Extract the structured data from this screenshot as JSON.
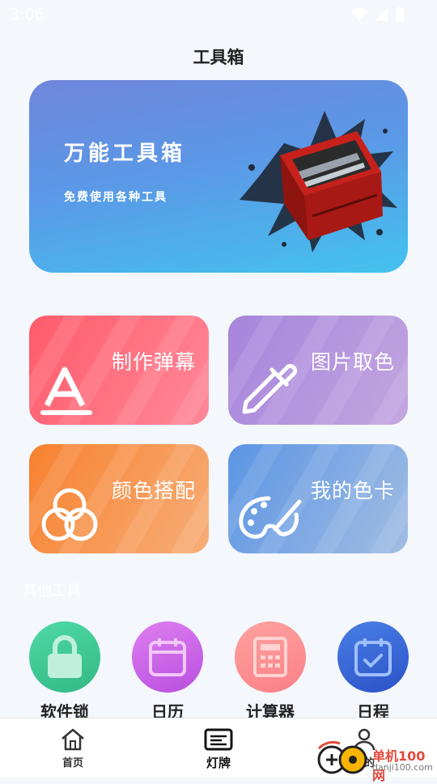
{
  "status": {
    "time": "3:06"
  },
  "header": {
    "title": "工具箱"
  },
  "banner": {
    "title": "万能工具箱",
    "subtitle": "免费使用各种工具"
  },
  "features": [
    {
      "label": "制作弹幕",
      "icon": "letter-a-icon"
    },
    {
      "label": "图片取色",
      "icon": "eyedropper-icon"
    },
    {
      "label": "颜色搭配",
      "icon": "color-circles-icon"
    },
    {
      "label": "我的色卡",
      "icon": "palette-icon"
    }
  ],
  "other_tools": {
    "title": "其他工具",
    "items": [
      {
        "label": "软件锁",
        "icon": "lock-icon",
        "color": "#3fc594"
      },
      {
        "label": "日历",
        "icon": "calendar-icon",
        "color": "#cb66e8"
      },
      {
        "label": "计算器",
        "icon": "calculator-icon",
        "color": "#fd8e8e"
      },
      {
        "label": "日程",
        "icon": "schedule-icon",
        "color": "#3c6ad9"
      }
    ]
  },
  "nav": {
    "items": [
      {
        "label": "首页",
        "icon": "home-icon"
      },
      {
        "label": "灯牌",
        "icon": "marquee-icon",
        "active": true
      },
      {
        "label": "我的",
        "icon": "profile-icon"
      }
    ]
  },
  "watermark": {
    "brand": "单机100网",
    "url": "danji100.com"
  }
}
